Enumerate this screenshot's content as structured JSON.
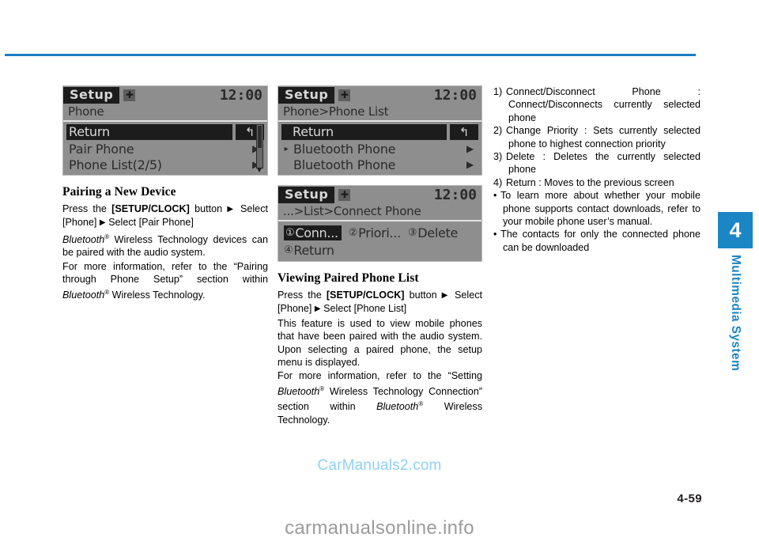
{
  "page": {
    "number": "4-59",
    "side_tab": {
      "chapter": "4",
      "label": "Multimedia System"
    },
    "watermark_center": "CarManuals2.com",
    "watermark_bottom": "carmanualsonline.info"
  },
  "screens": {
    "setup_phone": {
      "tab": "Setup",
      "bt_icon": "bluetooth-icon",
      "clock": "12:00",
      "path": "Phone",
      "return_label": "Return",
      "return_icon": "↰",
      "rows": [
        {
          "label": "Pair Phone",
          "arrow": "▶"
        },
        {
          "label": "Phone List(2/5)",
          "arrow": "▶"
        }
      ]
    },
    "phone_list": {
      "tab": "Setup",
      "bt_icon": "bluetooth-icon",
      "clock": "12:00",
      "path": "Phone>Phone List",
      "return_label": "Return",
      "return_icon": "↰",
      "rows": [
        {
          "bullet": "▸",
          "label": "Bluetooth Phone",
          "arrow": "▶"
        },
        {
          "bullet": "",
          "label": "Bluetooth Phone",
          "arrow": "▶"
        }
      ]
    },
    "connect_phone": {
      "tab": "Setup",
      "bt_icon": "bluetooth-icon",
      "clock": "12:00",
      "path": "...>List>Connect Phone",
      "menu_row1": [
        {
          "num": "①",
          "label": "Conn...",
          "selected": true
        },
        {
          "num": "②",
          "label": "Priori...",
          "selected": false
        },
        {
          "num": "③",
          "label": "Delete",
          "selected": false
        }
      ],
      "menu_row2": [
        {
          "num": "④",
          "label": "Return",
          "selected": false
        }
      ]
    }
  },
  "column1": {
    "heading": "Pairing a New Device",
    "steps": {
      "press": "Press the",
      "button": "[SETUP/CLOCK]",
      "button_tail": "button",
      "arrow1": "▶",
      "select_phone": "Select [Phone]",
      "arrow2": "▶",
      "select_pair": "Select [Pair Phone]"
    },
    "para1_brand": "Bluetooth",
    "para1_reg": "®",
    "para1_rest": " Wireless Technology devices can be paired with the audio system.",
    "para2_pre": "For more information, refer to the “Pairing through Phone Setup” section within ",
    "para2_brand": "Bluetooth",
    "para2_reg": "®",
    "para2_post": " Wireless Technology."
  },
  "column2": {
    "heading": "Viewing Paired Phone List",
    "steps": {
      "press": "Press the",
      "button": "[SETUP/CLOCK]",
      "button_tail": "button",
      "arrow1": "▶",
      "select_phone": "Select [Phone]",
      "arrow2": "▶",
      "select_list": "Select [Phone List]"
    },
    "para1": "This feature is used to view mobile phones that have been paired with the audio system. Upon selecting a paired phone, the setup menu is displayed.",
    "para2_pre": "For more information, refer to the “Setting ",
    "para2_brand1": "Bluetooth",
    "para2_reg1": "®",
    "para2_mid": " Wireless Technology Connection” section within ",
    "para2_brand2": "Bluetooth",
    "para2_reg2": "®",
    "para2_post": " Wireless Technology."
  },
  "column3": {
    "items": [
      {
        "num": "1)",
        "text": "Connect/Disconnect Phone : Connect/Disconnects currently selected phone"
      },
      {
        "num": "2)",
        "text": "Change Priority : Sets currently selected phone to highest connection priority"
      },
      {
        "num": "3)",
        "text": "Delete : Deletes the currently selected phone"
      },
      {
        "num": "4)",
        "text": "Return : Moves to the previous screen"
      }
    ],
    "bullets": [
      {
        "dot": "•",
        "text": "To learn more about whether your mobile phone supports contact downloads, refer to your mobile phone user’s manual."
      },
      {
        "dot": "•",
        "text": "The contacts for only the connected phone can be downloaded"
      }
    ]
  },
  "colors": {
    "accent_blue": "#1b86c4",
    "rule_blue": "#1b7fc3",
    "watermark_blue": "#8ed2f2",
    "watermark_gray": "#9b9b9b"
  }
}
